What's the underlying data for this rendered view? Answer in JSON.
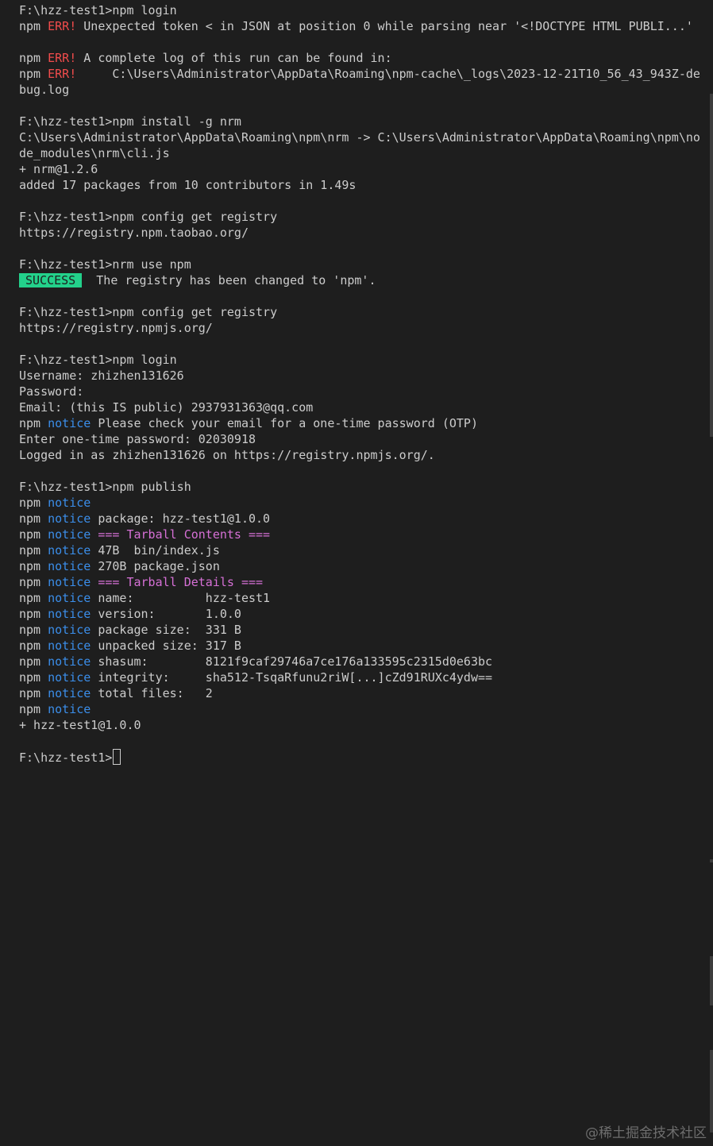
{
  "colors": {
    "background": "#1e1e1e",
    "foreground": "#cccccc",
    "err": "#f14c4c",
    "notice": "#3b8eea",
    "magenta": "#d670d6",
    "success_badge": "#23d18b"
  },
  "terminal": {
    "lines": [
      [
        {
          "t": "F:\\hzz-test1>npm login"
        }
      ],
      [
        {
          "t": "npm "
        },
        {
          "t": "ERR!",
          "c": "err"
        },
        {
          "t": " Unexpected token < in JSON at position 0 while parsing near '<!DOCTYPE HTML PUBLI...'"
        }
      ],
      [],
      [
        {
          "t": "npm "
        },
        {
          "t": "ERR!",
          "c": "err"
        },
        {
          "t": " A complete log of this run can be found in:"
        }
      ],
      [
        {
          "t": "npm "
        },
        {
          "t": "ERR!",
          "c": "err"
        },
        {
          "t": "     C:\\Users\\Administrator\\AppData\\Roaming\\npm-cache\\_logs\\2023-12-21T10_56_43_943Z-de"
        }
      ],
      [
        {
          "t": "bug.log"
        }
      ],
      [],
      [
        {
          "t": "F:\\hzz-test1>npm install -g nrm"
        }
      ],
      [
        {
          "t": "C:\\Users\\Administrator\\AppData\\Roaming\\npm\\nrm -> C:\\Users\\Administrator\\AppData\\Roaming\\npm\\no"
        }
      ],
      [
        {
          "t": "de_modules\\nrm\\cli.js"
        }
      ],
      [
        {
          "t": "+ nrm@1.2.6"
        }
      ],
      [
        {
          "t": "added 17 packages from 10 contributors in 1.49s"
        }
      ],
      [],
      [
        {
          "t": "F:\\hzz-test1>npm config get registry"
        }
      ],
      [
        {
          "t": "https://registry.npm.taobao.org/"
        }
      ],
      [],
      [
        {
          "t": "F:\\hzz-test1>nrm use npm"
        }
      ],
      [
        {
          "t": "SUCCESS",
          "c": "badge-success"
        },
        {
          "t": "  The registry has been changed to 'npm'."
        }
      ],
      [],
      [
        {
          "t": "F:\\hzz-test1>npm config get registry"
        }
      ],
      [
        {
          "t": "https://registry.npmjs.org/"
        }
      ],
      [],
      [
        {
          "t": "F:\\hzz-test1>npm login"
        }
      ],
      [
        {
          "t": "Username: zhizhen131626"
        }
      ],
      [
        {
          "t": "Password:"
        }
      ],
      [
        {
          "t": "Email: (this IS public) 2937931363@qq.com"
        }
      ],
      [
        {
          "t": "npm "
        },
        {
          "t": "notice",
          "c": "notice"
        },
        {
          "t": " Please check your email for a one-time password (OTP)"
        }
      ],
      [
        {
          "t": "Enter one-time password: 02030918"
        }
      ],
      [
        {
          "t": "Logged in as zhizhen131626 on https://registry.npmjs.org/."
        }
      ],
      [],
      [
        {
          "t": "F:\\hzz-test1>npm publish"
        }
      ],
      [
        {
          "t": "npm "
        },
        {
          "t": "notice",
          "c": "notice"
        }
      ],
      [
        {
          "t": "npm "
        },
        {
          "t": "notice",
          "c": "notice"
        },
        {
          "t": " package: hzz-test1@1.0.0"
        }
      ],
      [
        {
          "t": "npm "
        },
        {
          "t": "notice",
          "c": "notice"
        },
        {
          "t": " === Tarball Contents ===",
          "c": "magenta"
        }
      ],
      [
        {
          "t": "npm "
        },
        {
          "t": "notice",
          "c": "notice"
        },
        {
          "t": " 47B  bin/index.js"
        }
      ],
      [
        {
          "t": "npm "
        },
        {
          "t": "notice",
          "c": "notice"
        },
        {
          "t": " 270B package.json"
        }
      ],
      [
        {
          "t": "npm "
        },
        {
          "t": "notice",
          "c": "notice"
        },
        {
          "t": " === Tarball Details ===",
          "c": "magenta"
        }
      ],
      [
        {
          "t": "npm "
        },
        {
          "t": "notice",
          "c": "notice"
        },
        {
          "t": " name:          hzz-test1"
        }
      ],
      [
        {
          "t": "npm "
        },
        {
          "t": "notice",
          "c": "notice"
        },
        {
          "t": " version:       1.0.0"
        }
      ],
      [
        {
          "t": "npm "
        },
        {
          "t": "notice",
          "c": "notice"
        },
        {
          "t": " package size:  331 B"
        }
      ],
      [
        {
          "t": "npm "
        },
        {
          "t": "notice",
          "c": "notice"
        },
        {
          "t": " unpacked size: 317 B"
        }
      ],
      [
        {
          "t": "npm "
        },
        {
          "t": "notice",
          "c": "notice"
        },
        {
          "t": " shasum:        8121f9caf29746a7ce176a133595c2315d0e63bc"
        }
      ],
      [
        {
          "t": "npm "
        },
        {
          "t": "notice",
          "c": "notice"
        },
        {
          "t": " integrity:     sha512-TsqaRfunu2riW[...]cZd91RUXc4ydw=="
        }
      ],
      [
        {
          "t": "npm "
        },
        {
          "t": "notice",
          "c": "notice"
        },
        {
          "t": " total files:   2"
        }
      ],
      [
        {
          "t": "npm "
        },
        {
          "t": "notice",
          "c": "notice"
        }
      ],
      [
        {
          "t": "+ hzz-test1@1.0.0"
        }
      ],
      [],
      [
        {
          "t": "F:\\hzz-test1>"
        },
        {
          "cursor": true
        }
      ]
    ]
  },
  "watermark": "@稀土掘金技术社区"
}
